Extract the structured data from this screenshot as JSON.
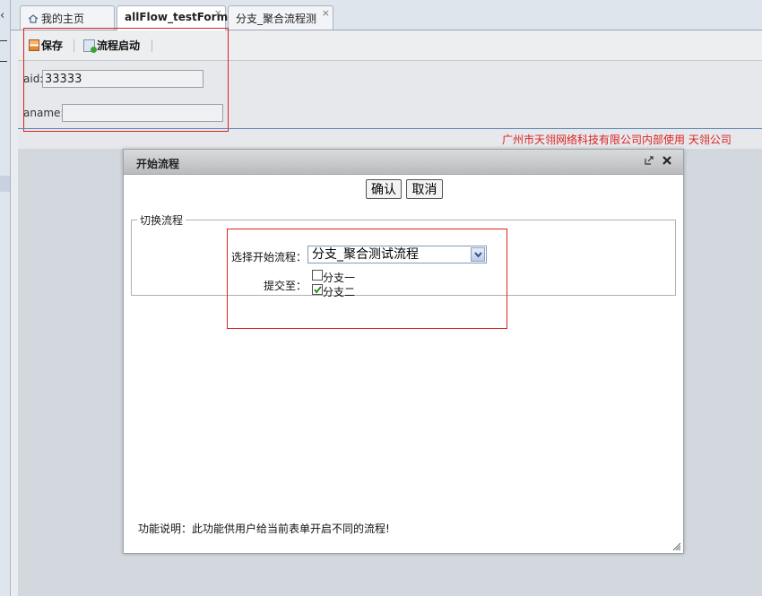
{
  "tabs": [
    {
      "label": "我的主页",
      "icon": "home-icon",
      "closable": false
    },
    {
      "label": "allFlow_testForm",
      "active": true,
      "closable": true
    },
    {
      "label": "分支_聚合流程测",
      "closable": true
    }
  ],
  "tab_close_glyph": "×",
  "toolbar": {
    "save_label": "保存",
    "start_label": "流程启动"
  },
  "form": {
    "aid_label": "aid:",
    "aid_value": "33333",
    "aname_label": "aname:",
    "aname_value": ""
  },
  "company_text": "广州市天翎网络科技有限公司内部使用 天翎公司",
  "modal": {
    "title": "开始流程",
    "confirm_label": "确认",
    "cancel_label": "取消",
    "fieldset_legend": "切换流程",
    "select_flow_label": "选择开始流程：",
    "selected_flow": "分支_聚合测试流程",
    "submit_to_label": "提交至：",
    "branches": [
      {
        "label": "分支一",
        "checked": false
      },
      {
        "label": "分支二",
        "checked": true
      }
    ],
    "note": "功能说明：此功能供用户给当前表单开启不同的流程!"
  },
  "colors": {
    "annotation_red": "#dd2222",
    "company_text": "#dd2222",
    "separator_blue": "#5b85b6"
  }
}
